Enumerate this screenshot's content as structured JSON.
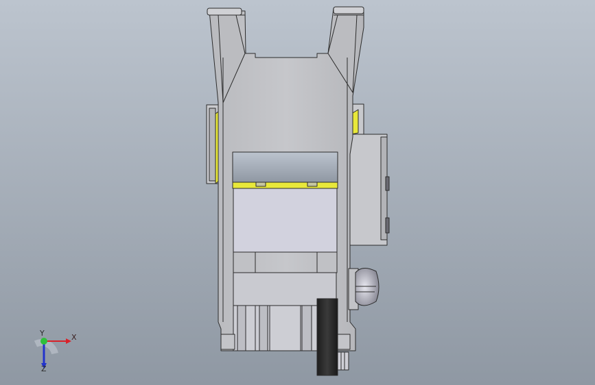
{
  "viewport": {
    "background_top": "#b9c1cb",
    "background_bottom": "#8d96a1"
  },
  "model": {
    "frame_color": "#c3c4c8",
    "slide_color": "#d0d0dc",
    "accent_yellow": "#e8e83a",
    "edge_color": "#2b2b2b",
    "dark_part_color": "#262626"
  },
  "triad": {
    "x_label": "X",
    "y_label": "Y",
    "z_label": "Z",
    "x_color": "#d9222a",
    "y_color": "#2fbf3a",
    "z_color": "#2233cc"
  }
}
